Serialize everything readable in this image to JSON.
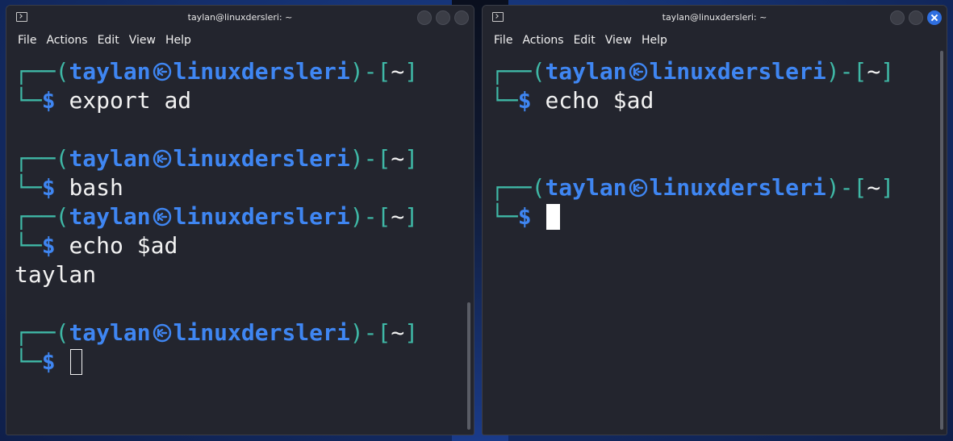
{
  "windows": [
    {
      "id": "left",
      "title": "taylan@linuxdersleri: ~",
      "menu": [
        "File",
        "Actions",
        "Edit",
        "View",
        "Help"
      ],
      "prompt": {
        "open": "┌──(",
        "user": "taylan",
        "host": "linuxdersleri",
        "mid": ")-[",
        "cwd": "~",
        "close": "]",
        "corner": "└─",
        "dollar": "$"
      },
      "lines": [
        {
          "kind": "prompt-top"
        },
        {
          "kind": "prompt-cmd",
          "cmd": "export ad"
        },
        {
          "kind": "blank"
        },
        {
          "kind": "prompt-top"
        },
        {
          "kind": "prompt-cmd",
          "cmd": "bash"
        },
        {
          "kind": "prompt-top"
        },
        {
          "kind": "prompt-cmd",
          "cmd": "echo $ad"
        },
        {
          "kind": "output",
          "text": "taylan"
        },
        {
          "kind": "blank"
        },
        {
          "kind": "prompt-top"
        },
        {
          "kind": "prompt-cursor",
          "cursor": "hollow"
        }
      ],
      "active": false
    },
    {
      "id": "right",
      "title": "taylan@linuxdersleri: ~",
      "menu": [
        "File",
        "Actions",
        "Edit",
        "View",
        "Help"
      ],
      "prompt": {
        "open": "┌──(",
        "user": "taylan",
        "host": "linuxdersleri",
        "mid": ")-[",
        "cwd": "~",
        "close": "]",
        "corner": "└─",
        "dollar": "$"
      },
      "lines": [
        {
          "kind": "prompt-top"
        },
        {
          "kind": "prompt-cmd",
          "cmd": "echo $ad"
        },
        {
          "kind": "blank"
        },
        {
          "kind": "blank"
        },
        {
          "kind": "prompt-top"
        },
        {
          "kind": "prompt-cursor",
          "cursor": "solid"
        }
      ],
      "active": true
    }
  ],
  "colors": {
    "terminal_bg": "#23252e",
    "prompt_frame": "#3fb8a6",
    "prompt_user_host": "#3f86f2",
    "command_text": "#f2f2f2",
    "close_button_active": "#2f6fe0"
  },
  "icons": {
    "window_icon": "terminal-icon",
    "separator_icon": "kali-dragon-icon",
    "window_buttons": [
      "minimize-icon",
      "maximize-icon",
      "close-icon"
    ]
  }
}
